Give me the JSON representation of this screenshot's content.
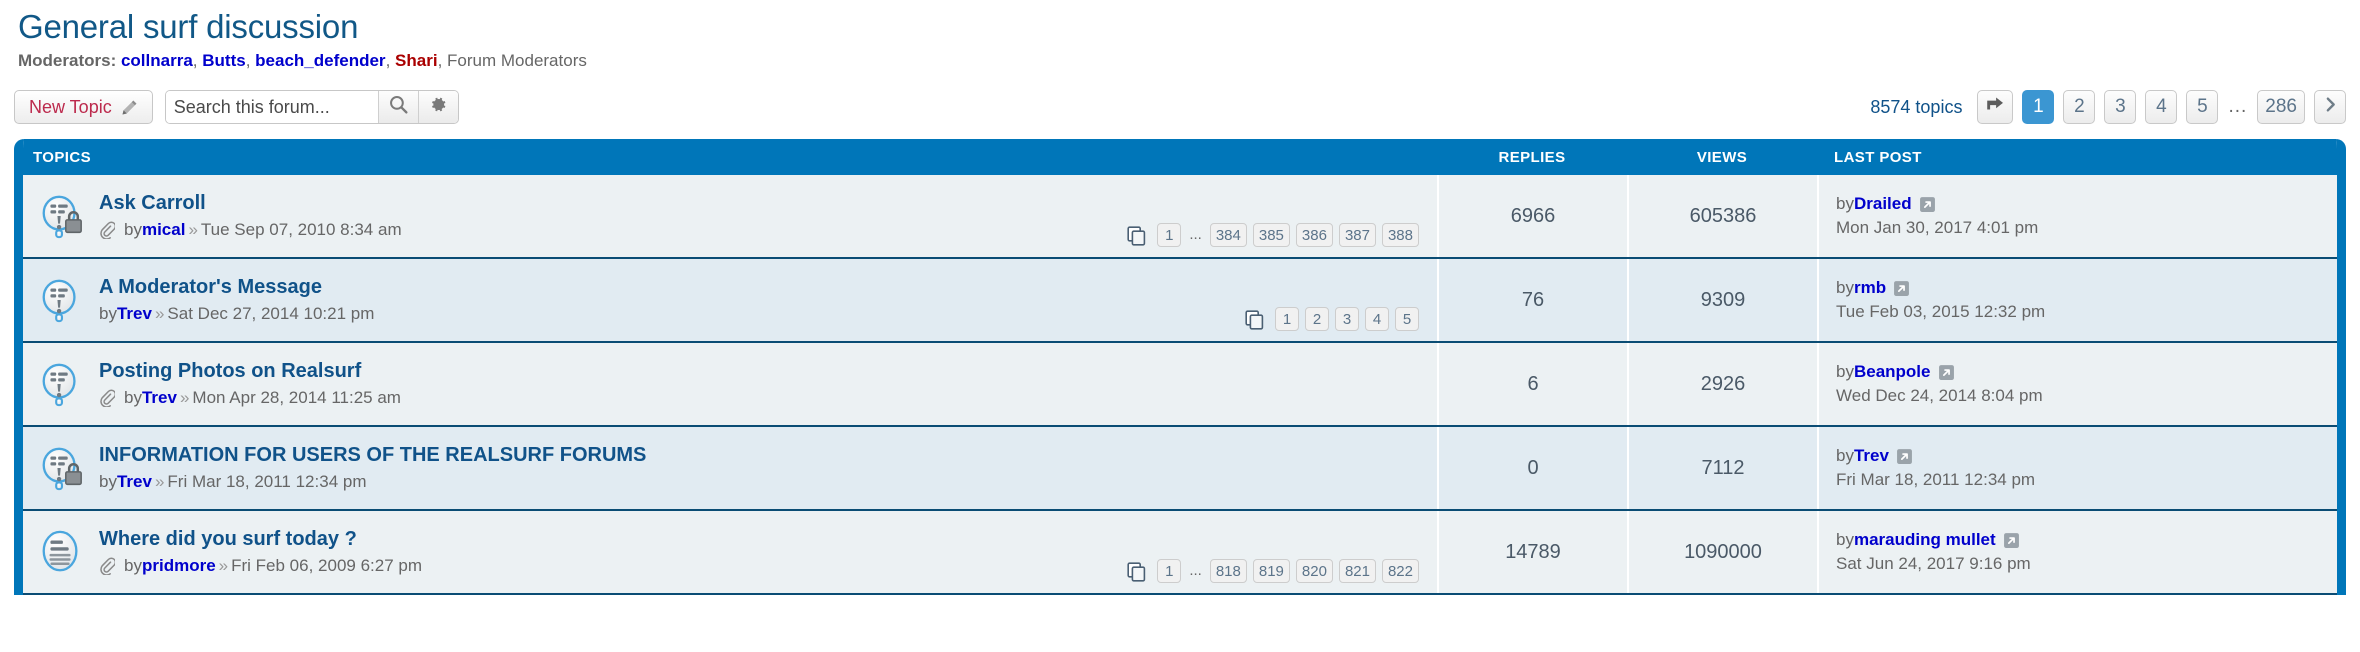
{
  "header": {
    "title": "General surf discussion",
    "moderators_label": "Moderators:",
    "moderators": [
      {
        "name": "collnarra",
        "style": "link"
      },
      {
        "name": "Butts",
        "style": "link"
      },
      {
        "name": "beach_defender",
        "style": "link"
      },
      {
        "name": "Shari",
        "style": "link-red"
      },
      {
        "name": "Forum Moderators",
        "style": "plain"
      }
    ]
  },
  "toolbar": {
    "new_topic_label": "New Topic",
    "new_topic_icon": "pencil-icon",
    "search_placeholder": "Search this forum...",
    "search_value": "",
    "search_icon": "search-icon",
    "options_icon": "gear-icon"
  },
  "pagination": {
    "topics_count_label": "8574 topics",
    "jump_icon": "jump-to-page-icon",
    "pages": [
      "1",
      "2",
      "3",
      "4",
      "5"
    ],
    "active_page": "1",
    "ellipsis": "...",
    "last_page": "286",
    "next_icon": "chevron-right-icon"
  },
  "table": {
    "columns": {
      "topics": "TOPICS",
      "replies": "REPLIES",
      "views": "VIEWS",
      "last_post": "LAST POST"
    },
    "colors": {
      "header_blue": "#0076b9",
      "row_bg": "#ecf1f3",
      "row_bg_alt": "#e1ebf2",
      "title_link": "#105289",
      "author_link": "#0000cc",
      "active_page": "#3b96d2",
      "new_topic_red": "#bc2a4d"
    },
    "rows": [
      {
        "icon": "announce-locked-icon",
        "title": "Ask Carroll",
        "has_attachment": true,
        "by_label": "by",
        "author": "mical",
        "sep": "»",
        "posted": "Tue Sep 07, 2010 8:34 am",
        "pages": {
          "icon": "multipage-icon",
          "first": "1",
          "ellipsis": "...",
          "tail": [
            "384",
            "385",
            "386",
            "387",
            "388"
          ]
        },
        "replies": "6966",
        "views": "605386",
        "last_post": {
          "by_label": "by",
          "author": "Drailed",
          "goto_icon": "goto-last-post-icon",
          "date": "Mon Jan 30, 2017 4:01 pm"
        }
      },
      {
        "icon": "announce-icon",
        "title": "A Moderator's Message",
        "has_attachment": false,
        "by_label": "by",
        "author": "Trev",
        "sep": "»",
        "posted": "Sat Dec 27, 2014 10:21 pm",
        "pages": {
          "icon": "multipage-icon",
          "first": "",
          "ellipsis": "",
          "tail": [
            "1",
            "2",
            "3",
            "4",
            "5"
          ]
        },
        "replies": "76",
        "views": "9309",
        "last_post": {
          "by_label": "by",
          "author": "rmb",
          "goto_icon": "goto-last-post-icon",
          "date": "Tue Feb 03, 2015 12:32 pm"
        }
      },
      {
        "icon": "announce-icon",
        "title": "Posting Photos on Realsurf",
        "has_attachment": true,
        "by_label": "by",
        "author": "Trev",
        "sep": "»",
        "posted": "Mon Apr 28, 2014 11:25 am",
        "pages": null,
        "replies": "6",
        "views": "2926",
        "last_post": {
          "by_label": "by",
          "author": "Beanpole",
          "goto_icon": "goto-last-post-icon",
          "date": "Wed Dec 24, 2014 8:04 pm"
        }
      },
      {
        "icon": "announce-locked-icon",
        "title": "INFORMATION FOR USERS OF THE REALSURF FORUMS",
        "has_attachment": false,
        "by_label": "by",
        "author": "Trev",
        "sep": "»",
        "posted": "Fri Mar 18, 2011 12:34 pm",
        "pages": null,
        "replies": "0",
        "views": "7112",
        "last_post": {
          "by_label": "by",
          "author": "Trev",
          "goto_icon": "goto-last-post-icon",
          "date": "Fri Mar 18, 2011 12:34 pm"
        }
      },
      {
        "icon": "sticky-topic-icon",
        "title": "Where did you surf today ?",
        "has_attachment": true,
        "by_label": "by",
        "author": "pridmore",
        "sep": "»",
        "posted": "Fri Feb 06, 2009 6:27 pm",
        "pages": {
          "icon": "multipage-icon",
          "first": "1",
          "ellipsis": "...",
          "tail": [
            "818",
            "819",
            "820",
            "821",
            "822"
          ]
        },
        "replies": "14789",
        "views": "1090000",
        "last_post": {
          "by_label": "by",
          "author": "marauding mullet",
          "goto_icon": "goto-last-post-icon",
          "date": "Sat Jun 24, 2017 9:16 pm"
        }
      }
    ]
  }
}
